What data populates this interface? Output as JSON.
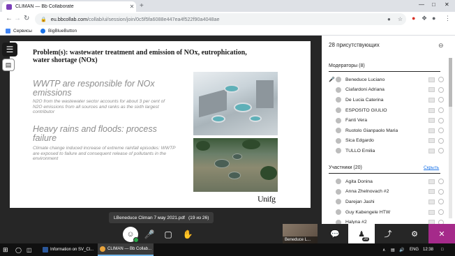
{
  "browser": {
    "tab_title": "CLIMAN — Bb Collaborate",
    "tab_close": "✕",
    "new_tab": "+",
    "url_host": "eu.bbcollab.com",
    "url_path": "/collab/ui/session/join/0c5f5fa6088e447ea4f522f90a4048ae",
    "bookmarks": [
      {
        "label": "Сервисы",
        "color": "#4285f4"
      },
      {
        "label": "BigBlueButton",
        "color": "#1a73e8"
      }
    ]
  },
  "slide": {
    "title": "Problem(s): wastewater treatment and emission of NOx, eutrophication, water shortage (NOx)",
    "heading1": "WWTP are responsible for NOx emissions",
    "body1": "N2O from the wastewater sector accounts for about 3 per cent of N2O emissions from all sources and ranks as the sixth largest contributor",
    "heading2": "Heavy rains and floods: process failure",
    "body2": "Climate change induced increase of extreme rainfall episodes: WWTP are exposed to failure and consequent release of pollutants in the environment",
    "logo": "Unifg"
  },
  "caption": {
    "file": "LBeneduce Climan 7 мау 2021.pdf",
    "pages": "(19 из 26)"
  },
  "video": {
    "name": "Beneduce L..."
  },
  "panel": {
    "header": "28 присутствующих",
    "moderators_header": "Модераторы (8)",
    "moderators": [
      {
        "name": "Beneduce Luciano",
        "speaking": true
      },
      {
        "name": "Ciafardoni Adriana",
        "speaking": false
      },
      {
        "name": "De Lucia Caterina",
        "speaking": false
      },
      {
        "name": "ESPOSITO GIULIO",
        "speaking": false
      },
      {
        "name": "Fanti Vera",
        "speaking": false
      },
      {
        "name": "Ruotolo Gianpaolo Maria",
        "speaking": false
      },
      {
        "name": "Sica Edgardo",
        "speaking": false
      },
      {
        "name": "TULLO Emilia",
        "speaking": false
      }
    ],
    "participants_header": "Участники (20)",
    "hide_label": "Скрыть",
    "participants": [
      {
        "name": "Agita Donina"
      },
      {
        "name": "Anna Zhelnovach #2"
      },
      {
        "name": "Darejan Jashi"
      },
      {
        "name": "Guy Kabengele HTW"
      },
      {
        "name": "Halyna #2"
      }
    ],
    "attendee_badge": "28"
  },
  "taskbar": {
    "items": [
      {
        "label": "Information on SV_Cl...",
        "color": "#2b579a",
        "active": false
      },
      {
        "label": "CLIMAN — Bb Collab...",
        "color": "#e8a33c",
        "active": true
      }
    ],
    "lang": "ENG",
    "time": "12:38"
  }
}
